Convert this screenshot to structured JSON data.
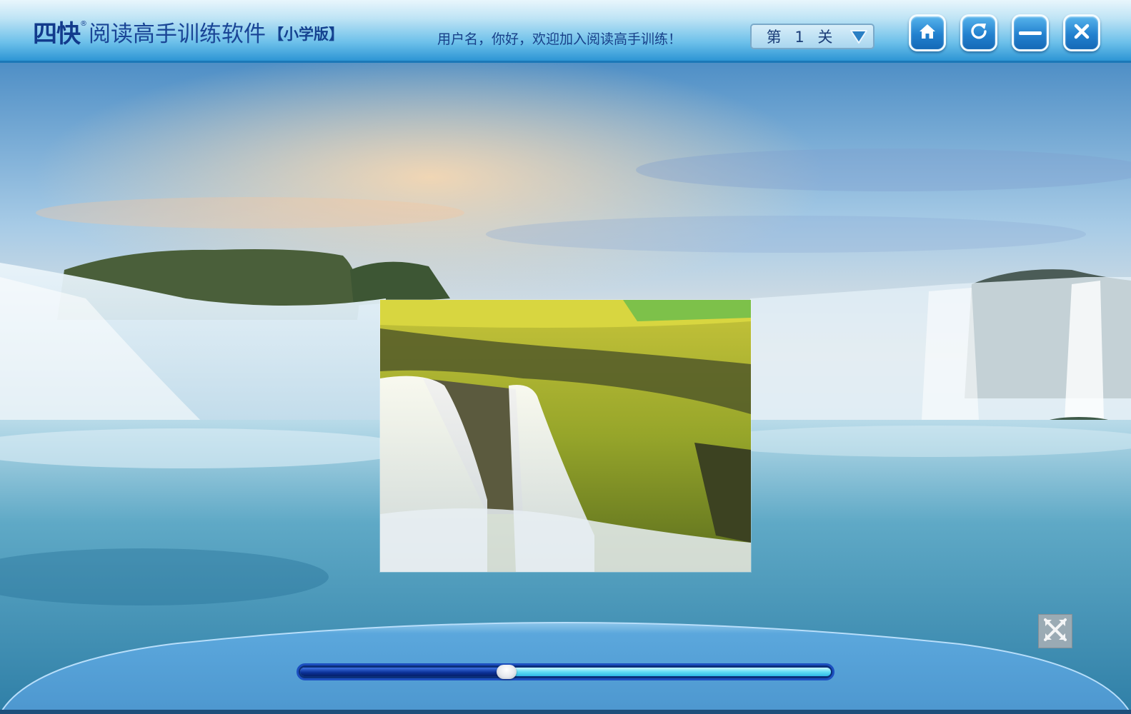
{
  "header": {
    "logo_text": "四快",
    "registered_mark": "®",
    "app_title": "阅读高手训练软件",
    "edition": "【小学版】",
    "welcome_message": "用户名，你好，欢迎加入阅读高手训练！",
    "level_selector": {
      "selected": "第 1 关"
    },
    "buttons": {
      "home": "home-icon",
      "refresh": "refresh-icon",
      "minimize": "minimize-icon",
      "close": "close-icon"
    }
  },
  "stage": {
    "background": "waterfall landscape",
    "photo": "waterfall photo",
    "fullscreen_button": "expand-icon"
  },
  "playback": {
    "progress": 0.39
  },
  "colors": {
    "header_text": "#1a4596",
    "accent_blue": "#2281cf",
    "slider_fill": "#0a2f95",
    "slider_track": "#61dcf4",
    "bottom_panel": "#5aa5d8"
  }
}
